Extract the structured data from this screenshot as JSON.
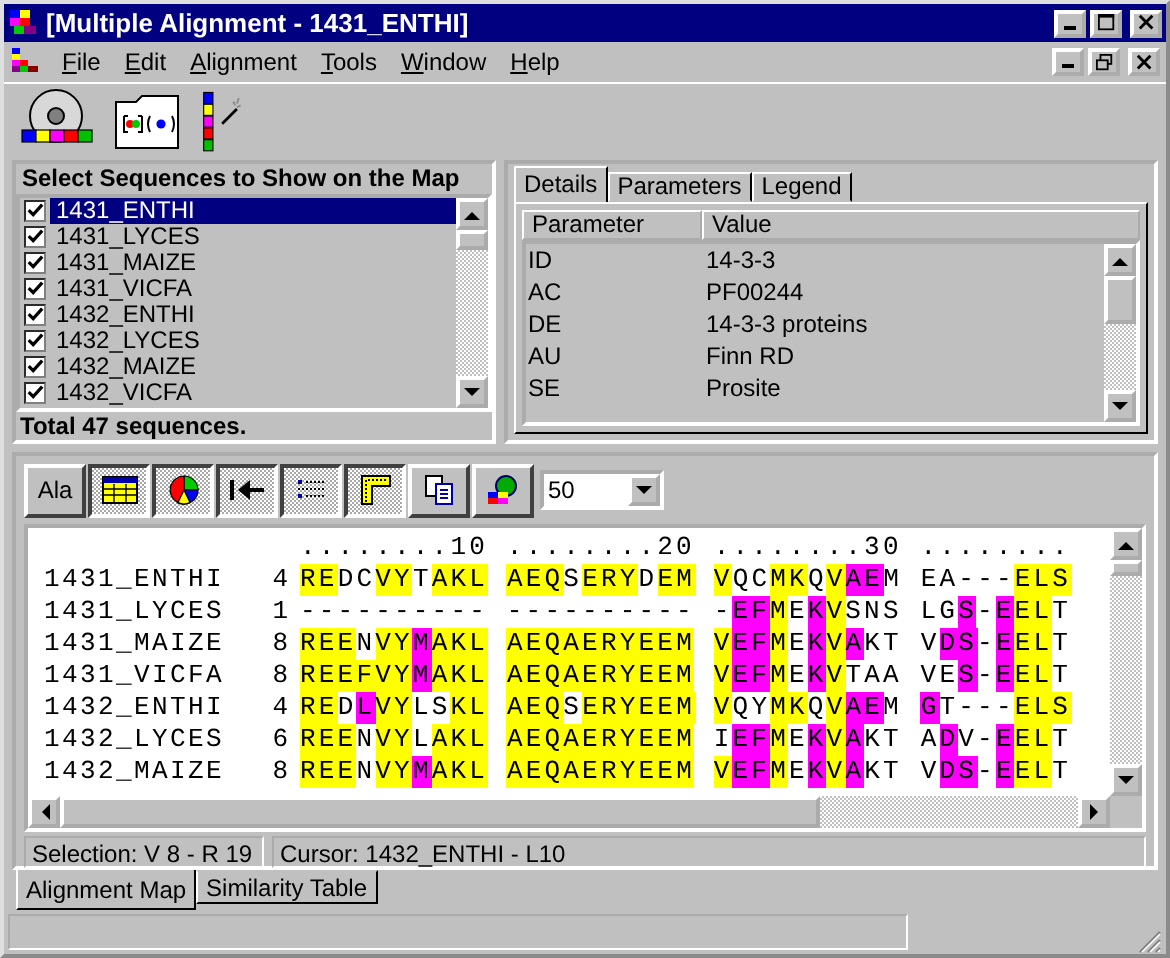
{
  "window": {
    "title": "[Multiple Alignment - 1431_ENTHI]"
  },
  "menu": [
    "File",
    "Edit",
    "Alignment",
    "Tools",
    "Window",
    "Help"
  ],
  "sequence_list": {
    "title": "Select Sequences to Show on the Map",
    "footer": "Total 47 sequences.",
    "items": [
      {
        "label": "1431_ENTHI",
        "checked": true,
        "selected": true
      },
      {
        "label": "1431_LYCES",
        "checked": true,
        "selected": false
      },
      {
        "label": "1431_MAIZE",
        "checked": true,
        "selected": false
      },
      {
        "label": "1431_VICFA",
        "checked": true,
        "selected": false
      },
      {
        "label": "1432_ENTHI",
        "checked": true,
        "selected": false
      },
      {
        "label": "1432_LYCES",
        "checked": true,
        "selected": false
      },
      {
        "label": "1432_MAIZE",
        "checked": true,
        "selected": false
      },
      {
        "label": "1432_VICFA",
        "checked": true,
        "selected": false
      }
    ]
  },
  "details": {
    "tabs": [
      {
        "label": "Details",
        "selected": true
      },
      {
        "label": "Parameters",
        "selected": false
      },
      {
        "label": "Legend",
        "selected": false
      }
    ],
    "columns": [
      "Parameter",
      "Value"
    ],
    "rows": [
      {
        "parameter": "ID",
        "value": "14-3-3"
      },
      {
        "parameter": "AC",
        "value": "PF00244"
      },
      {
        "parameter": "DE",
        "value": "14-3-3 proteins"
      },
      {
        "parameter": "AU",
        "value": "Finn RD"
      },
      {
        "parameter": "SE",
        "value": "Prosite"
      }
    ]
  },
  "alignment": {
    "tool_buttons": [
      {
        "kind": "text",
        "label": "Ala",
        "pressed": false
      },
      {
        "kind": "table",
        "pressed": true
      },
      {
        "kind": "pie",
        "pressed": true
      },
      {
        "kind": "jump",
        "pressed": true
      },
      {
        "kind": "list",
        "pressed": true
      },
      {
        "kind": "corner",
        "pressed": true
      },
      {
        "kind": "copy",
        "pressed": false
      },
      {
        "kind": "globe",
        "pressed": false
      }
    ],
    "window_size": "50",
    "ruler": "........10 ........20 ........30 ........",
    "rows": [
      {
        "name": "1431_ENTHI",
        "start": "4",
        "blocks": [
          [
            {
              "text": "RE",
              "color": "#ffff00"
            },
            {
              "text": "DC"
            },
            {
              "text": "VY",
              "color": "#ffff00"
            },
            {
              "text": "T"
            },
            {
              "text": "AKL",
              "color": "#ffff00"
            }
          ],
          [
            {
              "text": "AEQ",
              "color": "#ffff00"
            },
            {
              "text": "S"
            },
            {
              "text": "ERY",
              "color": "#ffff00"
            },
            {
              "text": "D"
            },
            {
              "text": "EM",
              "color": "#ffff00"
            }
          ],
          [
            {
              "text": "V",
              "color": "#ffff00"
            },
            {
              "text": "QC"
            },
            {
              "text": "MK",
              "color": "#ffff00"
            },
            {
              "text": "Q"
            },
            {
              "text": "V",
              "color": "#ffff00"
            },
            {
              "text": "AE",
              "color": "#ff00ff"
            },
            {
              "text": "M"
            }
          ],
          [
            {
              "text": "EA---"
            },
            {
              "text": "ELS",
              "color": "#ffff00"
            }
          ]
        ]
      },
      {
        "name": "1431_LYCES",
        "start": "1",
        "blocks": [
          [
            {
              "text": "----------"
            }
          ],
          [
            {
              "text": "----------"
            }
          ],
          [
            {
              "text": "-"
            },
            {
              "text": "EF",
              "color": "#ff00ff"
            },
            {
              "text": "M",
              "color": "#ffff00"
            },
            {
              "text": "E"
            },
            {
              "text": "K",
              "color": "#ff00ff"
            },
            {
              "text": "V",
              "color": "#ffff00"
            },
            {
              "text": "SNS"
            }
          ],
          [
            {
              "text": "LG"
            },
            {
              "text": "S",
              "color": "#ff00ff"
            },
            {
              "text": "-"
            },
            {
              "text": "E",
              "color": "#ff00ff"
            },
            {
              "text": "EL",
              "color": "#ffff00"
            },
            {
              "text": "T"
            }
          ]
        ]
      },
      {
        "name": "1431_MAIZE",
        "start": "8",
        "blocks": [
          [
            {
              "text": "REE",
              "color": "#ffff00"
            },
            {
              "text": "N"
            },
            {
              "text": "VY",
              "color": "#ffff00"
            },
            {
              "text": "M",
              "color": "#ff00ff"
            },
            {
              "text": "AKL",
              "color": "#ffff00"
            }
          ],
          [
            {
              "text": "AEQAERYEEM",
              "color": "#ffff00"
            }
          ],
          [
            {
              "text": "V",
              "color": "#ffff00"
            },
            {
              "text": "EF",
              "color": "#ff00ff"
            },
            {
              "text": "M",
              "color": "#ffff00"
            },
            {
              "text": "E"
            },
            {
              "text": "K",
              "color": "#ff00ff"
            },
            {
              "text": "V",
              "color": "#ffff00"
            },
            {
              "text": "A",
              "color": "#ff00ff"
            },
            {
              "text": "KT"
            }
          ],
          [
            {
              "text": "V"
            },
            {
              "text": "DS",
              "color": "#ff00ff"
            },
            {
              "text": "-"
            },
            {
              "text": "E",
              "color": "#ff00ff"
            },
            {
              "text": "EL",
              "color": "#ffff00"
            },
            {
              "text": "T"
            }
          ]
        ]
      },
      {
        "name": "1431_VICFA",
        "start": "8",
        "blocks": [
          [
            {
              "text": "REEFVY",
              "color": "#ffff00"
            },
            {
              "text": "M",
              "color": "#ff00ff"
            },
            {
              "text": "AKL",
              "color": "#ffff00"
            }
          ],
          [
            {
              "text": "AEQAERYEEM",
              "color": "#ffff00"
            }
          ],
          [
            {
              "text": "V",
              "color": "#ffff00"
            },
            {
              "text": "EF",
              "color": "#ff00ff"
            },
            {
              "text": "M",
              "color": "#ffff00"
            },
            {
              "text": "E"
            },
            {
              "text": "K",
              "color": "#ff00ff"
            },
            {
              "text": "V",
              "color": "#ffff00"
            },
            {
              "text": "TAA"
            }
          ],
          [
            {
              "text": "VE"
            },
            {
              "text": "S",
              "color": "#ff00ff"
            },
            {
              "text": "-"
            },
            {
              "text": "E",
              "color": "#ff00ff"
            },
            {
              "text": "EL",
              "color": "#ffff00"
            },
            {
              "text": "T"
            }
          ]
        ]
      },
      {
        "name": "1432_ENTHI",
        "start": "4",
        "blocks": [
          [
            {
              "text": "RE",
              "color": "#ffff00"
            },
            {
              "text": "D"
            },
            {
              "text": "L",
              "color": "#ff00ff"
            },
            {
              "text": "VY",
              "color": "#ffff00"
            },
            {
              "text": "LS"
            },
            {
              "text": "KL",
              "color": "#ffff00"
            }
          ],
          [
            {
              "text": "AEQ",
              "color": "#ffff00"
            },
            {
              "text": "S"
            },
            {
              "text": "ERYEEM",
              "color": "#ffff00"
            }
          ],
          [
            {
              "text": "V",
              "color": "#ffff00"
            },
            {
              "text": "QY"
            },
            {
              "text": "MK",
              "color": "#ffff00"
            },
            {
              "text": "Q"
            },
            {
              "text": "V",
              "color": "#ffff00"
            },
            {
              "text": "AE",
              "color": "#ff00ff"
            },
            {
              "text": "M"
            }
          ],
          [
            {
              "text": "G",
              "color": "#ff00ff"
            },
            {
              "text": "T---"
            },
            {
              "text": "ELS",
              "color": "#ffff00"
            }
          ]
        ]
      },
      {
        "name": "1432_LYCES",
        "start": "6",
        "blocks": [
          [
            {
              "text": "REE",
              "color": "#ffff00"
            },
            {
              "text": "N"
            },
            {
              "text": "VY",
              "color": "#ffff00"
            },
            {
              "text": "L"
            },
            {
              "text": "AKL",
              "color": "#ffff00"
            }
          ],
          [
            {
              "text": "AEQAERYEEM",
              "color": "#ffff00"
            }
          ],
          [
            {
              "text": "I"
            },
            {
              "text": "EF",
              "color": "#ff00ff"
            },
            {
              "text": "M",
              "color": "#ffff00"
            },
            {
              "text": "E"
            },
            {
              "text": "K",
              "color": "#ff00ff"
            },
            {
              "text": "V",
              "color": "#ffff00"
            },
            {
              "text": "A",
              "color": "#ff00ff"
            },
            {
              "text": "KT"
            }
          ],
          [
            {
              "text": "A"
            },
            {
              "text": "D",
              "color": "#ff00ff"
            },
            {
              "text": "V-"
            },
            {
              "text": "E",
              "color": "#ff00ff"
            },
            {
              "text": "EL",
              "color": "#ffff00"
            },
            {
              "text": "T"
            }
          ]
        ]
      },
      {
        "name": "1432_MAIZE",
        "start": "8",
        "blocks": [
          [
            {
              "text": "REE",
              "color": "#ffff00"
            },
            {
              "text": "N"
            },
            {
              "text": "VY",
              "color": "#ffff00"
            },
            {
              "text": "M",
              "color": "#ff00ff"
            },
            {
              "text": "AKL",
              "color": "#ffff00"
            }
          ],
          [
            {
              "text": "AEQAERYEEM",
              "color": "#ffff00"
            }
          ],
          [
            {
              "text": "V",
              "color": "#ffff00"
            },
            {
              "text": "EF",
              "color": "#ff00ff"
            },
            {
              "text": "M",
              "color": "#ffff00"
            },
            {
              "text": "E"
            },
            {
              "text": "K",
              "color": "#ff00ff"
            },
            {
              "text": "V",
              "color": "#ffff00"
            },
            {
              "text": "A",
              "color": "#ff00ff"
            },
            {
              "text": "KT"
            }
          ],
          [
            {
              "text": "V"
            },
            {
              "text": "DS",
              "color": "#ff00ff"
            },
            {
              "text": "-"
            },
            {
              "text": "E",
              "color": "#ff00ff"
            },
            {
              "text": "EL",
              "color": "#ffff00"
            },
            {
              "text": "T"
            }
          ]
        ]
      }
    ]
  },
  "status": {
    "selection": "Selection: V 8 - R 19",
    "cursor": "Cursor: 1432_ENTHI - L10"
  },
  "view_tabs": [
    {
      "label": "Alignment Map",
      "selected": true
    },
    {
      "label": "Similarity Table",
      "selected": false
    }
  ]
}
